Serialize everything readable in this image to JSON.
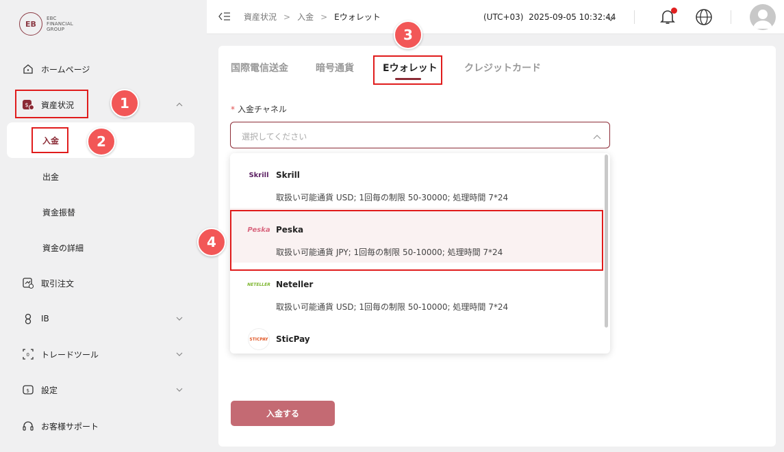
{
  "brand": {
    "logo_lines": [
      "EBC",
      "FINANCIAL",
      "GROUP"
    ],
    "mark": "EB"
  },
  "sidebar": {
    "items": [
      {
        "label": "ホームページ"
      },
      {
        "label": "資産状況"
      },
      {
        "label": "取引注文"
      },
      {
        "label": "IB"
      },
      {
        "label": "トレードツール"
      },
      {
        "label": "設定"
      },
      {
        "label": "お客様サポート"
      }
    ],
    "sub_items": [
      {
        "label": "入金"
      },
      {
        "label": "出金"
      },
      {
        "label": "資金振替"
      },
      {
        "label": "資金の詳細"
      }
    ]
  },
  "header": {
    "breadcrumb": [
      "資産状況",
      "入金",
      "Eウォレット"
    ],
    "datetime": "(UTC+03)  2025-09-05 10:32:44"
  },
  "tabs": [
    "国際電信送金",
    "暗号通貨",
    "Eウォレット",
    "クレジットカード"
  ],
  "form": {
    "channel_label": "入金チャネル",
    "required_mark": "*",
    "select_placeholder": "選択してください",
    "submit_label": "入金する"
  },
  "options": [
    {
      "name": "Skrill",
      "logo_text": "Skrill",
      "desc": "取扱い可能通貨 USD; 1回毎の制限 50-30000; 処理時間 7*24"
    },
    {
      "name": "Peska",
      "logo_text": "Peska",
      "desc": "取扱い可能通貨 JPY; 1回毎の制限 50-10000; 処理時間 7*24"
    },
    {
      "name": "Neteller",
      "logo_text": "NETELLER",
      "desc": "取扱い可能通貨 USD; 1回毎の制限 50-10000; 処理時間 7*24"
    },
    {
      "name": "SticPay",
      "logo_text": "STICPAY",
      "desc": ""
    }
  ],
  "annotations": [
    "1",
    "2",
    "3",
    "4"
  ],
  "colors": {
    "accent": "#8b2a35",
    "annotation": "#e01b1b",
    "badge": "#f25757",
    "submit": "#c46a73"
  },
  "icons": [
    "home-icon",
    "assets-icon",
    "orders-icon",
    "ib-icon",
    "tools-icon",
    "settings-icon",
    "support-icon",
    "collapse-icon",
    "bell-icon",
    "globe-icon",
    "avatar-icon",
    "chevron-down-icon",
    "chevron-up-icon"
  ]
}
